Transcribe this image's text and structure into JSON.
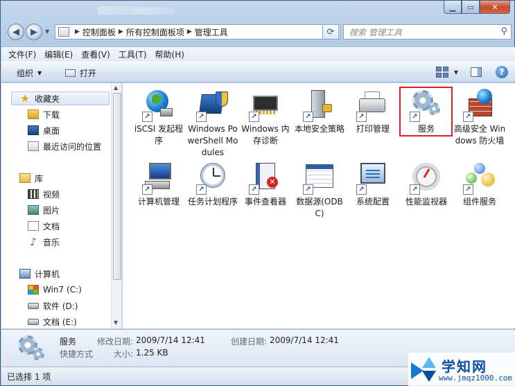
{
  "address": {
    "crumbs": [
      "控制面板",
      "所有控制面板项",
      "管理工具"
    ],
    "search_placeholder": "搜索 管理工具"
  },
  "menu": [
    "文件(F)",
    "编辑(E)",
    "查看(V)",
    "工具(T)",
    "帮助(H)"
  ],
  "toolbar": {
    "organize": "组织",
    "open": "打开"
  },
  "nav": {
    "favorites": "收藏夹",
    "downloads": "下载",
    "desktop": "桌面",
    "recent": "最近访问的位置",
    "libraries": "库",
    "videos": "视频",
    "pictures": "图片",
    "documents": "文档",
    "music": "音乐",
    "computer": "计算机",
    "drive_c": "Win7 (C:)",
    "drive_d": "软件 (D:)",
    "drive_e": "文档 (E:)"
  },
  "items": [
    {
      "label": "iSCSI 发起程序",
      "icon": "iscsi-icon"
    },
    {
      "label": "Windows PowerShell Modules",
      "icon": "powershell-icon"
    },
    {
      "label": "Windows 内存诊断",
      "icon": "memory-chip-icon"
    },
    {
      "label": "本地安全策略",
      "icon": "security-policy-icon"
    },
    {
      "label": "打印管理",
      "icon": "printer-icon"
    },
    {
      "label": "服务",
      "icon": "services-gear-icon"
    },
    {
      "label": "高级安全 Windows 防火墙",
      "icon": "firewall-icon"
    },
    {
      "label": "计算机管理",
      "icon": "computer-management-icon"
    },
    {
      "label": "任务计划程序",
      "icon": "clock-icon"
    },
    {
      "label": "事件查看器",
      "icon": "event-viewer-icon"
    },
    {
      "label": "数据源(ODBC)",
      "icon": "database-icon"
    },
    {
      "label": "系统配置",
      "icon": "system-config-icon"
    },
    {
      "label": "性能监视器",
      "icon": "gauge-icon"
    },
    {
      "label": "组件服务",
      "icon": "component-services-icon"
    }
  ],
  "details": {
    "name": "服务",
    "type": "快捷方式",
    "modified_label": "修改日期:",
    "modified_value": "2009/7/14 12:41",
    "created_label": "创建日期:",
    "created_value": "2009/7/14 12:41",
    "size_label": "大小:",
    "size_value": "1.25 KB"
  },
  "status": "已选择 1 项",
  "watermark": {
    "title": "学知网",
    "url": "www.jmqz1000.com"
  },
  "colors": {
    "highlight_border": "#d8202a",
    "close_button": "#c64a2c"
  }
}
